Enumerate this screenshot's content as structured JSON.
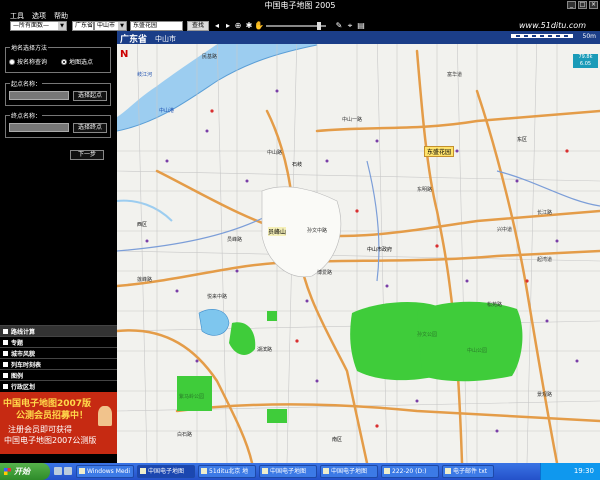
{
  "window": {
    "title": "中国电子地图 2005",
    "buttons": [
      "_",
      "□",
      "×"
    ]
  },
  "menu": [
    "工具",
    "选项",
    "帮助"
  ],
  "toolbar": {
    "scope_select": "—所有面数—",
    "province_select": "广东省",
    "city_select": "中山市",
    "search_value": "东盛花园",
    "search_button": "查找",
    "site": "www.51ditu.com",
    "icons": [
      "nav-back-icon",
      "nav-forward-icon",
      "zoom-in-icon",
      "zoom-out-icon",
      "hand-pan-icon",
      "gear-icon",
      "zoom-slider-icon",
      "pen-icon",
      "measure-icon",
      "print-icon"
    ]
  },
  "left_panel": {
    "method_group": "地名选择方法",
    "radio_name": "按名称查询",
    "radio_map": "地图选点",
    "start_group": "起点名称：",
    "start_button": "选择起点",
    "end_group": "终点名称：",
    "end_button": "选择终点",
    "next_button": "下一步"
  },
  "left_menu": [
    "路线计算",
    "专题",
    "城市风貌",
    "列车时刻表",
    "图例",
    "行政区划"
  ],
  "ad": {
    "line1": "中国电子地图2007版",
    "line2": "公测会员招募中！",
    "line3": "注册会员即可获得",
    "line4": "中国电子地图2007公测版"
  },
  "map": {
    "province": "广东省",
    "city": "中山市",
    "scale": "50m",
    "coords": "79.8k\n6.05",
    "compass": "N",
    "highlight": "东盛花园",
    "mountain": "员峰山",
    "labels": [
      {
        "t": "民基路",
        "c": "ml"
      },
      {
        "t": "中山港",
        "c": "ml"
      },
      {
        "t": "中山一路",
        "c": "ml"
      },
      {
        "t": "东盛花园",
        "c": "ml"
      },
      {
        "t": "富华道",
        "c": "ml"
      },
      {
        "t": "孙文中路",
        "c": "ml"
      },
      {
        "t": "兴中道",
        "c": "ml"
      },
      {
        "t": "中山市政府",
        "c": "ml bk"
      },
      {
        "t": "孙文公园",
        "c": "ml gr"
      },
      {
        "t": "紫马岭公园",
        "c": "ml gr"
      },
      {
        "t": "中山公园",
        "c": "ml gr"
      },
      {
        "t": "岐江河",
        "c": "ml blue"
      },
      {
        "t": "石岐",
        "c": "ml bk"
      },
      {
        "t": "东区",
        "c": "ml bk"
      },
      {
        "t": "西区",
        "c": "ml bk"
      },
      {
        "t": "南区",
        "c": "ml bk"
      },
      {
        "t": "莲峰路",
        "c": "ml"
      },
      {
        "t": "悦来中路",
        "c": "ml"
      },
      {
        "t": "博爱路",
        "c": "ml"
      },
      {
        "t": "中山路",
        "c": "ml"
      },
      {
        "t": "员峰路",
        "c": "ml"
      },
      {
        "t": "东明路",
        "c": "ml"
      },
      {
        "t": "长江路",
        "c": "ml"
      },
      {
        "t": "起湾道",
        "c": "ml"
      },
      {
        "t": "湖滨路",
        "c": "ml"
      },
      {
        "t": "松苑路",
        "c": "ml"
      },
      {
        "t": "白石路",
        "c": "ml"
      },
      {
        "t": "景观路",
        "c": "ml"
      }
    ]
  },
  "taskbar": {
    "start": "开始",
    "tasks": [
      "Windows Medi",
      "中国电子地图",
      "51ditu北京 地",
      "中国电子地图",
      "中国电子地图",
      "222-20 (D:)",
      "电子邮件 txt"
    ],
    "clock": "19:30"
  }
}
